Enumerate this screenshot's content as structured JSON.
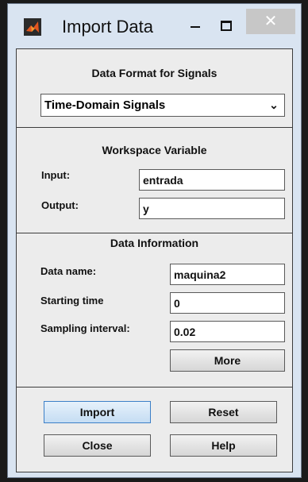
{
  "window": {
    "title": "Import Data",
    "close_glyph": "✕"
  },
  "format_panel": {
    "heading": "Data Format for Signals",
    "selected_option": "Time-Domain Signals",
    "arrow_glyph": "⌄"
  },
  "workspace_panel": {
    "heading": "Workspace Variable",
    "input_label": "Input:",
    "input_value": "entrada",
    "output_label": "Output:",
    "output_value": "y"
  },
  "info_panel": {
    "heading": "Data Information",
    "data_name_label": "Data name:",
    "data_name_value": "maquina2",
    "starting_time_label": "Starting time",
    "starting_time_value": "0",
    "sampling_interval_label": "Sampling interval:",
    "sampling_interval_value": "0.02",
    "more_label": "More"
  },
  "actions": {
    "import_label": "Import",
    "reset_label": "Reset",
    "close_label": "Close",
    "help_label": "Help"
  },
  "colors": {
    "window_frame": "#d9e4f1",
    "panel_bg": "#ececec",
    "primary_button_border": "#3c7fc7"
  }
}
